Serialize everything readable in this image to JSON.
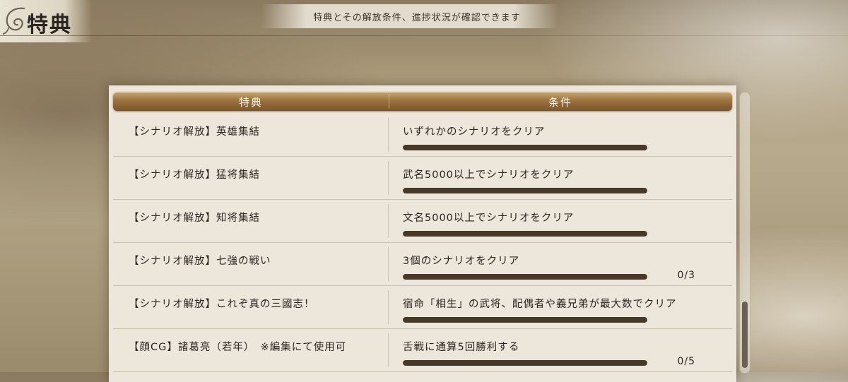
{
  "header": {
    "title": "特典",
    "subtitle": "特典とその解放条件、進捗状況が確認できます"
  },
  "table": {
    "col_reward": "特典",
    "col_condition": "条件"
  },
  "rows": [
    {
      "reward": "【シナリオ解放】英雄集結",
      "condition": "いずれかのシナリオをクリア",
      "progress": 1.0,
      "count": ""
    },
    {
      "reward": "【シナリオ解放】猛将集結",
      "condition": "武名5000以上でシナリオをクリア",
      "progress": 1.0,
      "count": ""
    },
    {
      "reward": "【シナリオ解放】知将集結",
      "condition": "文名5000以上でシナリオをクリア",
      "progress": 1.0,
      "count": ""
    },
    {
      "reward": "【シナリオ解放】七強の戦い",
      "condition": "3個のシナリオをクリア",
      "progress": 1.0,
      "count": "0/3"
    },
    {
      "reward": "【シナリオ解放】これぞ真の三國志！",
      "condition": "宿命「相生」の武将、配偶者や義兄弟が最大数でクリア",
      "progress": 1.0,
      "count": ""
    },
    {
      "reward": "【顔CG】諸葛亮（若年）　※編集にて使用可",
      "condition": "舌戦に通算5回勝利する",
      "progress": 1.0,
      "count": "0/5"
    }
  ],
  "icons": {
    "title_ornament": "swirl-ornament-icon"
  },
  "colors": {
    "header_gold": "#9b7441",
    "progress_fill": "#47392a"
  }
}
